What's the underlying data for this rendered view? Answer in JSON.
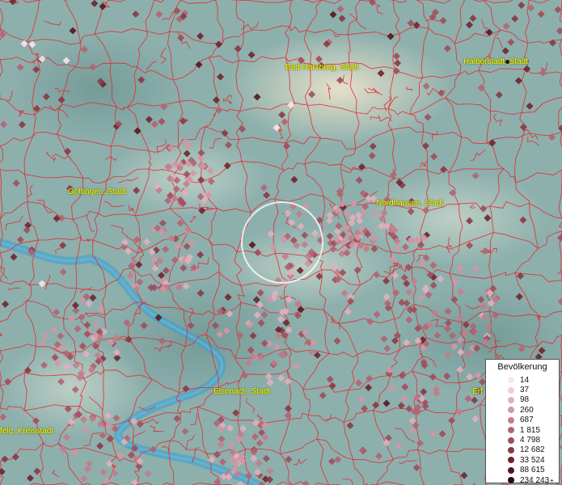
{
  "map": {
    "cities": [
      {
        "name": "Bad Harzburg, Stadt"
      },
      {
        "name": "Halberstadt, Stadt"
      },
      {
        "name": "Göttingen, Stadt"
      },
      {
        "name": "Nordhausen, Stadt"
      },
      {
        "name": "Eisenach, Stadt"
      },
      {
        "name": "feld, Kreisstadt"
      },
      {
        "name": "Erf"
      }
    ]
  },
  "legend": {
    "title": "Bevölkerung",
    "entries": [
      {
        "label": "14",
        "color": "#f9e6ec"
      },
      {
        "label": "37",
        "color": "#f0ccd6"
      },
      {
        "label": "98",
        "color": "#e2b0bd"
      },
      {
        "label": "260",
        "color": "#d396a5"
      },
      {
        "label": "687",
        "color": "#c27d8b"
      },
      {
        "label": "1 815",
        "color": "#b26472"
      },
      {
        "label": "4 798",
        "color": "#a04e5b"
      },
      {
        "label": "12 682",
        "color": "#8a3843"
      },
      {
        "label": "33 524",
        "color": "#6e2530"
      },
      {
        "label": "88 615",
        "color": "#521820"
      },
      {
        "label": "234 243",
        "color": "#2a0c10",
        "plus": "+"
      }
    ]
  },
  "colors": {
    "boundary": "#e8242c",
    "river": "#3a9fd0",
    "highlight_circle": "#ffffff"
  }
}
